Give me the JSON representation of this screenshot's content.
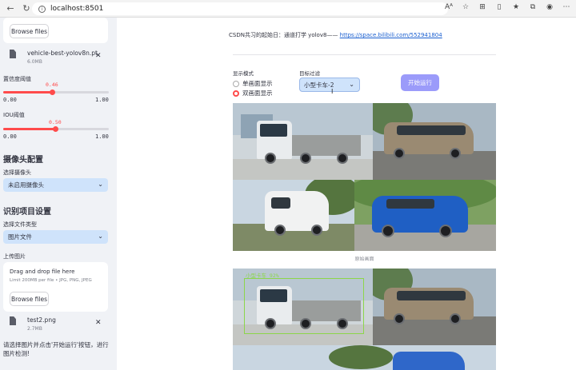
{
  "browser": {
    "url": "localhost:8501",
    "read_aloud": "Aᴬ"
  },
  "sidebar": {
    "top_uploader": {
      "browse_label": "Browse files"
    },
    "model_file": {
      "name": "vehicle-best-yolov8n.pt",
      "size": "6.0MB"
    },
    "confidence": {
      "label": "置信度阈值",
      "value": "0.46",
      "fraction": 0.46,
      "min": "0.00",
      "max": "1.00"
    },
    "iou": {
      "label": "IOU阈值",
      "value": "0.50",
      "fraction": 0.5,
      "min": "0.00",
      "max": "1.00"
    },
    "camera_section": {
      "title": "摄像头配置",
      "select_label": "选择摄像头",
      "selected": "未启用摄像头"
    },
    "recognition_section": {
      "title": "识别项目设置",
      "file_type_label": "选择文件类型",
      "file_type_selected": "图片文件",
      "upload_label": "上传图片",
      "drop_title": "Drag and drop file here",
      "drop_sub": "Limit 200MB per file • JPG, PNG, JPEG",
      "browse_label": "Browse files",
      "uploaded_file": {
        "name": "test2.png",
        "size": "2.7MB"
      }
    },
    "note": "请选择图片并点击'开始运行'按钮，进行图片检测!"
  },
  "main": {
    "intro_text": "CSDN共习的起始日：通道打学 yolov8——",
    "intro_link": "https://space.bilibili.com/552941804",
    "display_mode": {
      "label": "显示模式",
      "options": [
        "单画面显示",
        "双画面显示"
      ],
      "selected_index": 1
    },
    "target_filter": {
      "label": "目标过滤",
      "selected": "小型卡车-2"
    },
    "run_button": "开始运行",
    "original_caption": "原始画面",
    "detection": {
      "label": "小型卡车 92%"
    }
  },
  "colors": {
    "accent": "#ff4b4b",
    "select_bg": "#cfe3fb",
    "run_button": "#9b9bfa",
    "sidebar_bg": "#f0f2f6",
    "detection_box": "#8cd64a"
  }
}
